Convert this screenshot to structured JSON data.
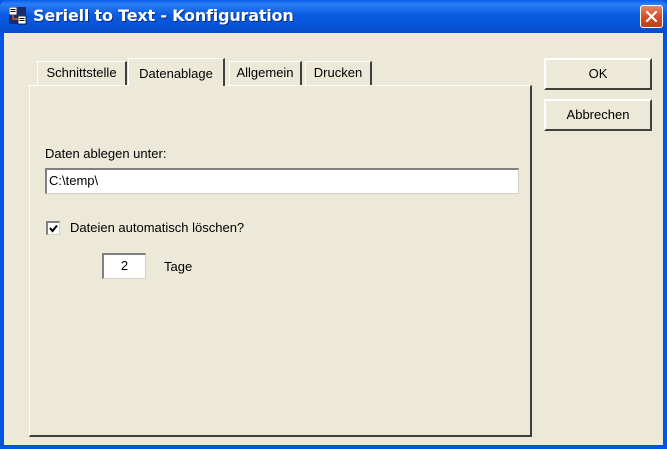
{
  "window": {
    "title": "Seriell to Text - Konfiguration",
    "titlebar_color": "#0a5be0",
    "close_color": "#d24c25"
  },
  "tabs": [
    {
      "label": "Schnittstelle",
      "active": false
    },
    {
      "label": "Datenablage",
      "active": true
    },
    {
      "label": "Allgemein",
      "active": false
    },
    {
      "label": "Drucken",
      "active": false
    }
  ],
  "panel": {
    "path_label": "Daten ablegen unter:",
    "path_value": "C:\\temp\\",
    "delete_checkbox_label": "Dateien automatisch löschen?",
    "delete_checked": true,
    "days_value": "2",
    "days_unit": "Tage"
  },
  "buttons": {
    "ok": "OK",
    "cancel": "Abbrechen"
  },
  "icons": {
    "app": "app-icon",
    "close": "close-icon",
    "checkmark": "checkmark-icon"
  }
}
